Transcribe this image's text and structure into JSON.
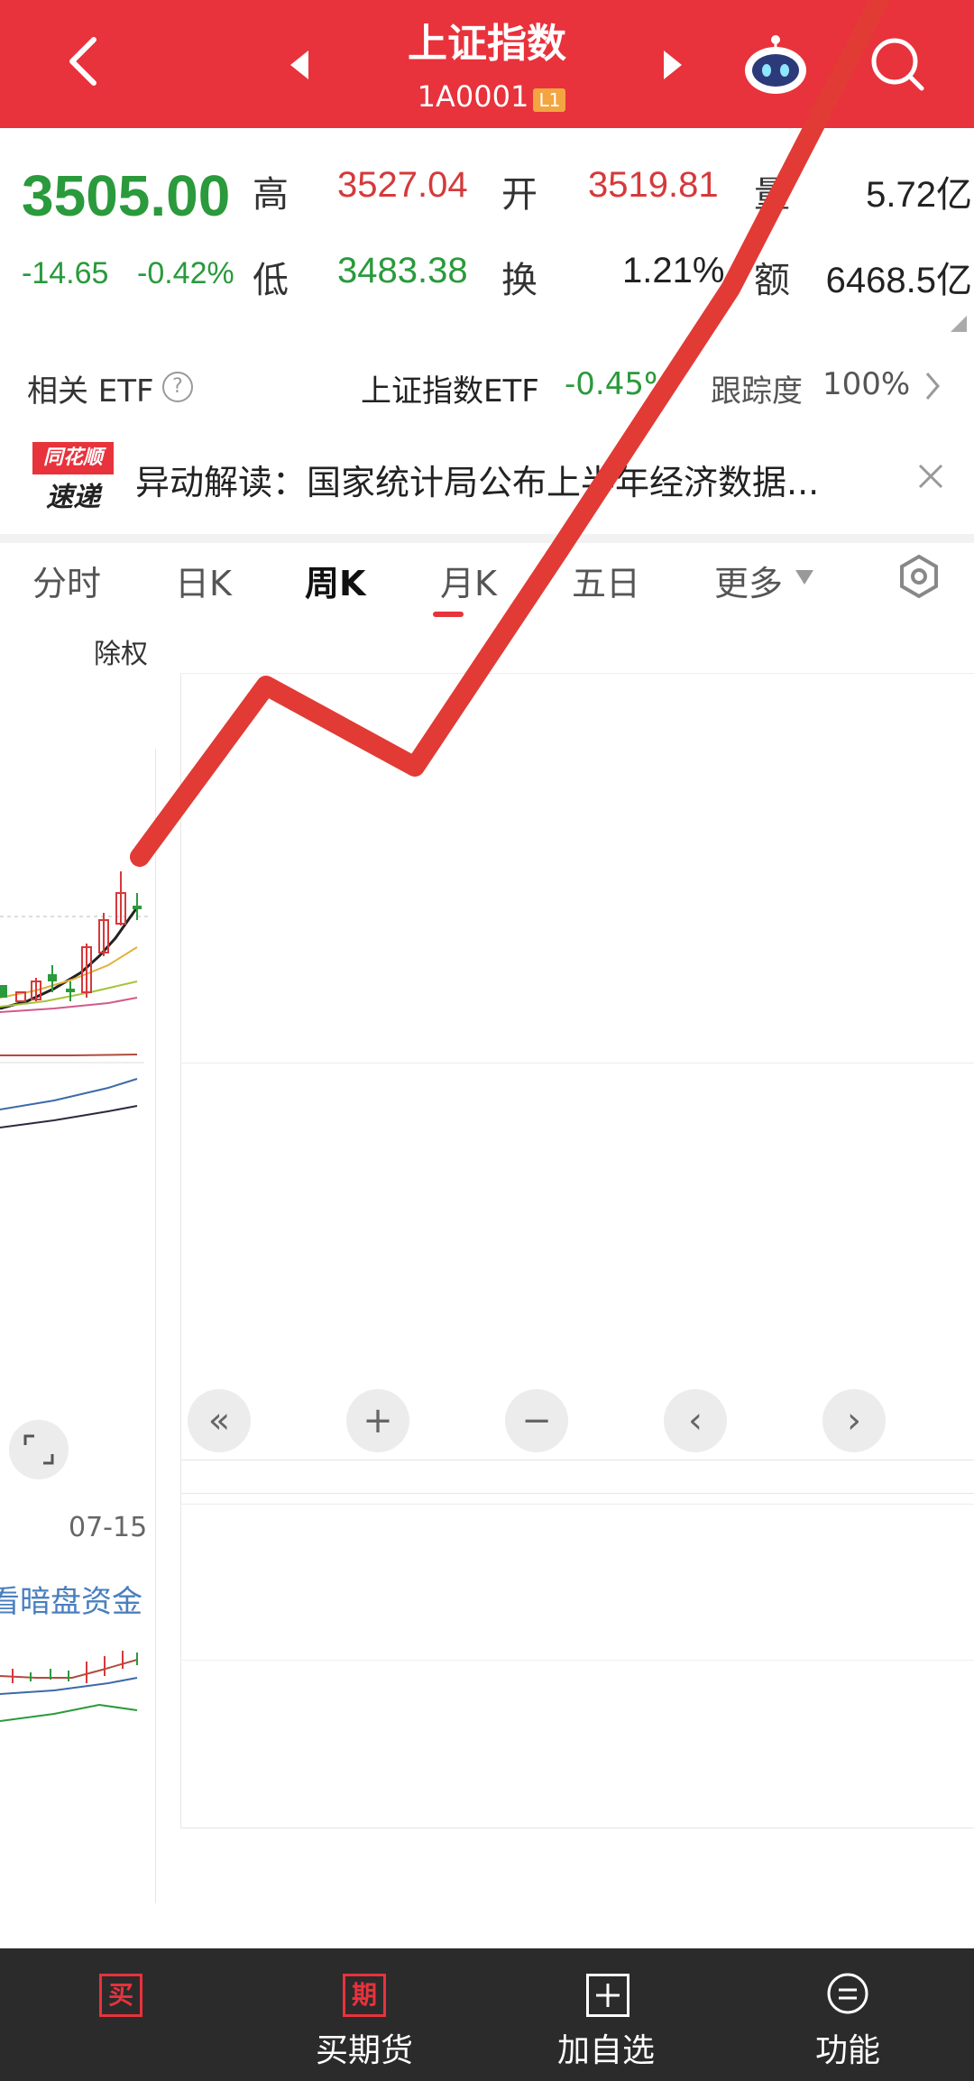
{
  "header": {
    "title": "上证指数",
    "code": "1A0001",
    "level_badge": "L1"
  },
  "quote": {
    "price": "3505.00",
    "change": "-14.65",
    "change_pct": "-0.42%",
    "high_label": "高",
    "high": "3527.04",
    "open_label": "开",
    "open": "3519.81",
    "volume_label": "量",
    "volume": "5.72亿",
    "low_label": "低",
    "low": "3483.38",
    "turnover_label": "换",
    "turnover": "1.21%",
    "amount_label": "额",
    "amount": "6468.5亿"
  },
  "etf": {
    "label": "相关 ETF",
    "name": "上证指数ETF",
    "change": "-0.45%",
    "track_label": "跟踪度",
    "track_value": "100%"
  },
  "news": {
    "logo_top": "同花顺",
    "logo_bottom": "速递",
    "text": "异动解读：国家统计局公布上半年经济数据..."
  },
  "tabs": [
    "分时",
    "日K",
    "周K",
    "月K",
    "五日",
    "更多"
  ],
  "active_tab": "周K",
  "chart": {
    "adjust_label": "除权",
    "date_label": "07-15",
    "fund_label": "看暗盘资金"
  },
  "chart_controls": [
    "«",
    "+",
    "−",
    "‹",
    "›"
  ],
  "bottom_bar": {
    "buy_icon": "买",
    "futures_icon": "期",
    "futures_label": "买期货",
    "add_label": "加自选",
    "func_label": "功能"
  },
  "colors": {
    "header_red": "#e8323c",
    "up_red": "#d6393b",
    "down_green": "#2a9a3c",
    "bottom_bar": "#2b2b2b"
  }
}
